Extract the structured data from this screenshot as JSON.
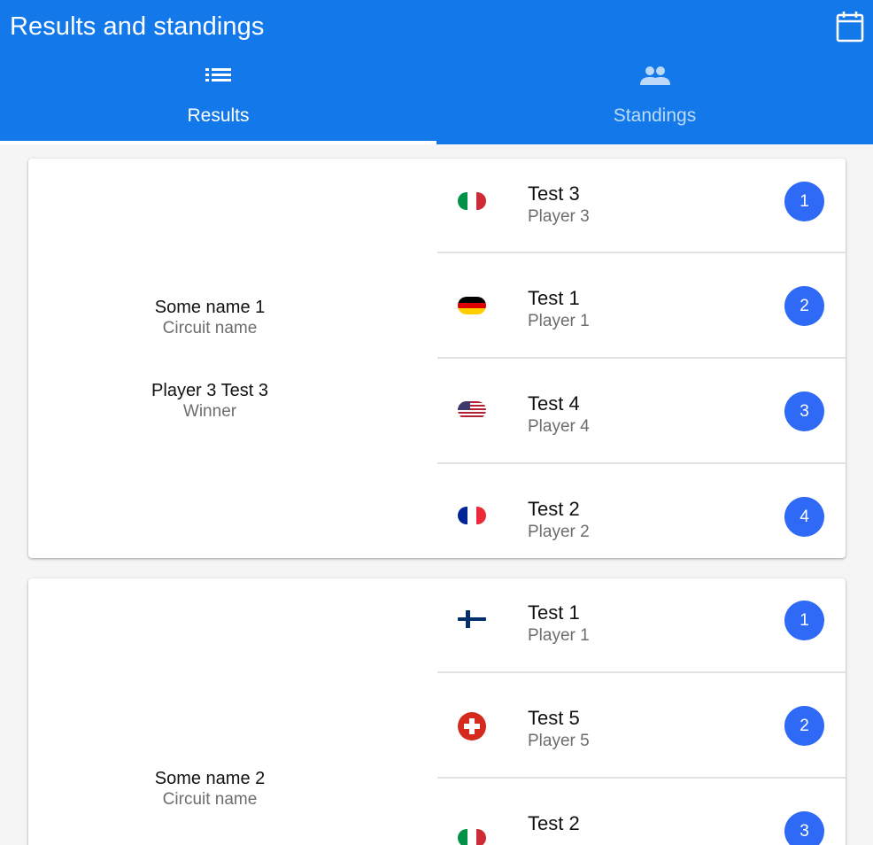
{
  "app": {
    "title": "Results and standings",
    "calendar_icon": "calendar-icon",
    "brand_color": "#1379ea",
    "position_color": "#2f6af7"
  },
  "tabs": [
    {
      "label": "Results",
      "icon": "list-icon",
      "active": true
    },
    {
      "label": "Standings",
      "icon": "group-icon",
      "active": false
    }
  ],
  "events": [
    {
      "name": "Some name 1",
      "circuit": "Circuit name",
      "winner": "Player 3 Test 3",
      "winner_label": "Winner",
      "results": [
        {
          "name": "Test 3",
          "player": "Player 3",
          "flag": "italy-flag-icon",
          "position": "1"
        },
        {
          "name": "Test 1",
          "player": "Player 1",
          "flag": "germany-flag-icon",
          "position": "2"
        },
        {
          "name": "Test 4",
          "player": "Player 4",
          "flag": "usa-flag-icon",
          "position": "3"
        },
        {
          "name": "Test 2",
          "player": "Player 2",
          "flag": "france-flag-icon",
          "position": "4"
        }
      ]
    },
    {
      "name": "Some name 2",
      "circuit": "Circuit name",
      "results": [
        {
          "name": "Test 1",
          "player": "Player 1",
          "flag": "finland-flag-icon",
          "position": "1"
        },
        {
          "name": "Test 5",
          "player": "Player 5",
          "flag": "switzerland-flag-icon",
          "position": "2"
        },
        {
          "name": "Test 2",
          "player": "",
          "flag": "italy-flag-icon",
          "position": "3"
        }
      ]
    }
  ]
}
